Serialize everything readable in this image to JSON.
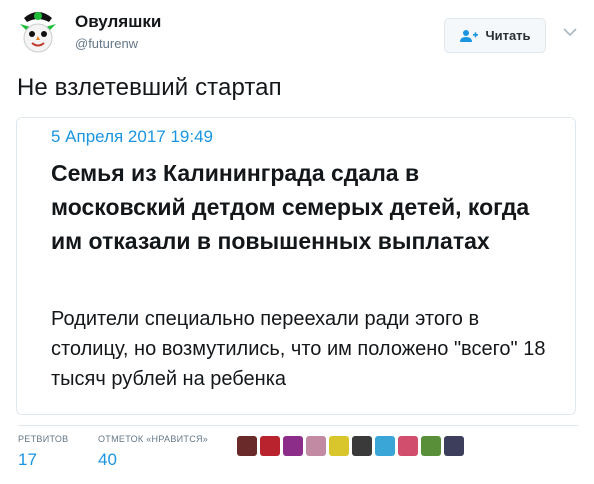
{
  "author": {
    "name": "Овуляшки",
    "handle": "@futurenw",
    "avatar_icon": "owl-avatar-icon"
  },
  "follow_button": {
    "label": "Читать",
    "icon": "follow-person-icon"
  },
  "more_menu_icon": "chevron-down-icon",
  "tweet_text": "Не взлетевший стартап",
  "card": {
    "date": "5 Апреля 2017 19:49",
    "headline": "Семья из Калининграда сдала в московский детдом семерых детей, когда им отказали в повышенных выплатах",
    "description": "Родители специально переехали ради этого в столицу, но возмутились, что им положено \"всего\" 18 тысяч рублей на ребенка"
  },
  "stats": {
    "retweets_label": "РЕТВИТОВ",
    "retweets_count": "17",
    "likes_label": "ОТМЕТОК «НРАВИТСЯ»",
    "likes_count": "40"
  },
  "liker_avatars": [
    {
      "name": "liker-avatar-1",
      "color": "#6b2a2a"
    },
    {
      "name": "liker-avatar-2",
      "color": "#b8232e"
    },
    {
      "name": "liker-avatar-3",
      "color": "#8d2d8a"
    },
    {
      "name": "liker-avatar-4",
      "color": "#c38aa4"
    },
    {
      "name": "liker-avatar-5",
      "color": "#d8c62c"
    },
    {
      "name": "liker-avatar-6",
      "color": "#3a3a3a"
    },
    {
      "name": "liker-avatar-7",
      "color": "#3aa6d8"
    },
    {
      "name": "liker-avatar-8",
      "color": "#d14f6d"
    },
    {
      "name": "liker-avatar-9",
      "color": "#5a8f3a"
    },
    {
      "name": "liker-avatar-10",
      "color": "#3d3d5c"
    }
  ],
  "colors": {
    "accent": "#1b95e0",
    "text": "#14171a",
    "muted": "#657786",
    "border": "#e1e8ed"
  }
}
